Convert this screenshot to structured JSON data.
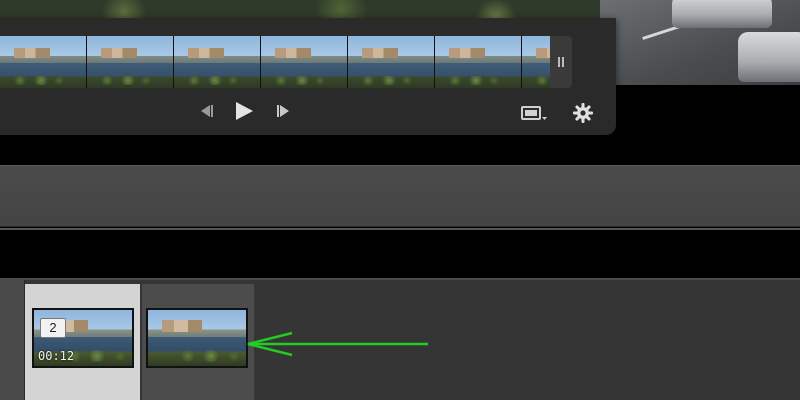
{
  "viewer": {
    "filmstrip": {
      "frame_count": 7,
      "pause_icon": "pause-icon"
    },
    "transport": {
      "previous_icon": "step-back-icon",
      "play_icon": "play-icon",
      "next_icon": "step-forward-icon"
    },
    "display_icon": "display-mode-icon",
    "settings_icon": "gear-icon"
  },
  "timeline": {
    "clips": [
      {
        "number": "2",
        "duration": "00:12",
        "selected": true
      },
      {
        "number": "",
        "duration": "",
        "selected": false
      }
    ]
  },
  "annotation": {
    "arrow_color": "#22cc22",
    "arrow_icon": "green-arrow-pointing-left"
  },
  "colors": {
    "panel": "#2a2a2a",
    "timeline_bg": "#353535",
    "selected_slot": "#d4d4d4",
    "accent_arrow": "#22cc22"
  }
}
